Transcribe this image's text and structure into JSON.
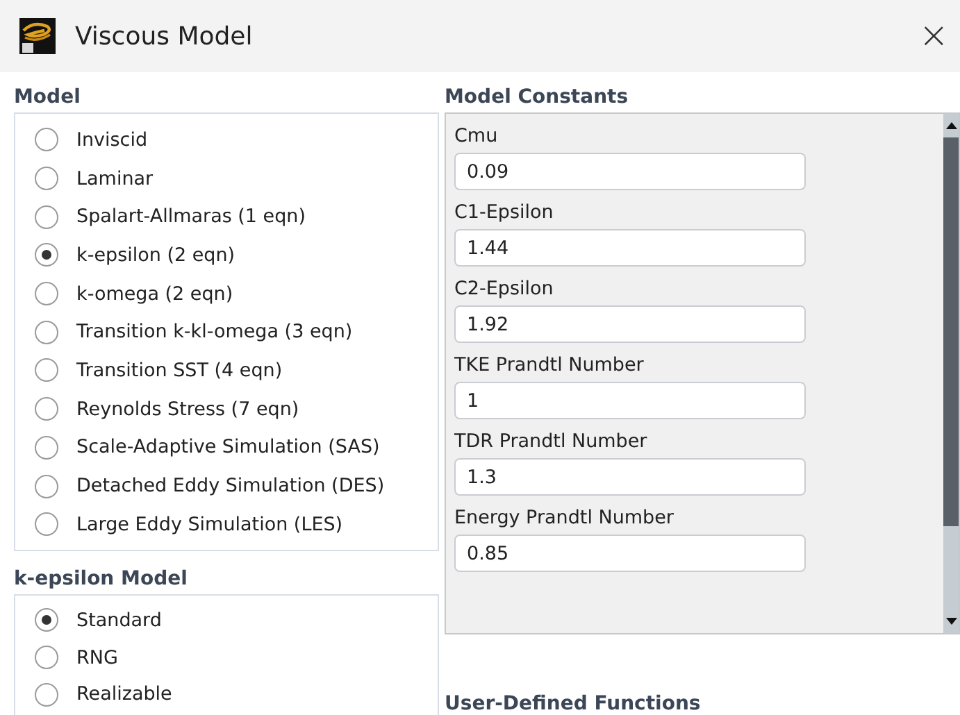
{
  "window": {
    "title": "Viscous Model",
    "close": "×"
  },
  "model": {
    "heading": "Model",
    "options": [
      {
        "label": "Inviscid",
        "selected": false
      },
      {
        "label": "Laminar",
        "selected": false
      },
      {
        "label": "Spalart-Allmaras (1 eqn)",
        "selected": false
      },
      {
        "label": "k-epsilon (2 eqn)",
        "selected": true
      },
      {
        "label": "k-omega (2 eqn)",
        "selected": false
      },
      {
        "label": "Transition k-kl-omega (3 eqn)",
        "selected": false
      },
      {
        "label": "Transition SST (4 eqn)",
        "selected": false
      },
      {
        "label": "Reynolds Stress (7 eqn)",
        "selected": false
      },
      {
        "label": "Scale-Adaptive Simulation (SAS)",
        "selected": false
      },
      {
        "label": "Detached Eddy Simulation (DES)",
        "selected": false
      },
      {
        "label": "Large Eddy Simulation (LES)",
        "selected": false
      }
    ]
  },
  "kepsilon_model": {
    "heading": "k-epsilon Model",
    "options": [
      {
        "label": "Standard",
        "selected": true
      },
      {
        "label": "RNG",
        "selected": false
      },
      {
        "label": "Realizable",
        "selected": false
      }
    ]
  },
  "model_constants": {
    "heading": "Model Constants",
    "fields": [
      {
        "label": "Cmu",
        "value": "0.09"
      },
      {
        "label": "C1-Epsilon",
        "value": "1.44"
      },
      {
        "label": "C2-Epsilon",
        "value": "1.92"
      },
      {
        "label": "TKE Prandtl Number",
        "value": "1"
      },
      {
        "label": "TDR Prandtl Number",
        "value": "1.3"
      },
      {
        "label": "Energy Prandtl Number",
        "value": "0.85"
      }
    ]
  },
  "user_defined_functions": {
    "heading": "User-Defined Functions"
  }
}
